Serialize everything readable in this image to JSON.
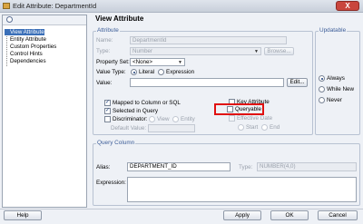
{
  "window": {
    "title": "Edit Attribute: DepartmentId",
    "close_label": "X"
  },
  "nav": {
    "items": [
      "View Attribute",
      "Entity Attribute",
      "Custom Properties",
      "Control Hints",
      "Dependencies"
    ]
  },
  "page": {
    "title": "View Attribute"
  },
  "attribute_group": {
    "title": "Attribute",
    "name_label": "Name:",
    "name_value": "DepartmentId",
    "type_label": "Type:",
    "type_value": "Number",
    "browse_label": "Browse...",
    "property_set_label": "Property Set:",
    "property_set_value": "<None>",
    "value_type_label": "Value Type:",
    "literal_label": "Literal",
    "expression_label": "Expression",
    "value_label": "Value:",
    "edit_label": "Edit...",
    "mapped_label": "Mapped to Column or SQL",
    "selected_label": "Selected in Query",
    "discriminator_label": "Discriminator:",
    "view_label": "View",
    "entity_label": "Entity",
    "default_value_label": "Default Value:",
    "key_attribute_label": "Key Attribute",
    "queryable_label": "Queryable",
    "effective_date_label": "Effective Date",
    "start_label": "Start",
    "end_label": "End"
  },
  "updatable_group": {
    "title": "Updatable",
    "options": [
      "Always",
      "While New",
      "Never"
    ]
  },
  "query_group": {
    "title": "Query Column",
    "alias_label": "Alias:",
    "alias_value": "DEPARTMENT_ID",
    "type_label": "Type:",
    "type_value": "NUMBER(4,0)",
    "expression_label": "Expression:"
  },
  "footer": {
    "help": "Help",
    "apply": "Apply",
    "ok": "OK",
    "cancel": "Cancel"
  }
}
